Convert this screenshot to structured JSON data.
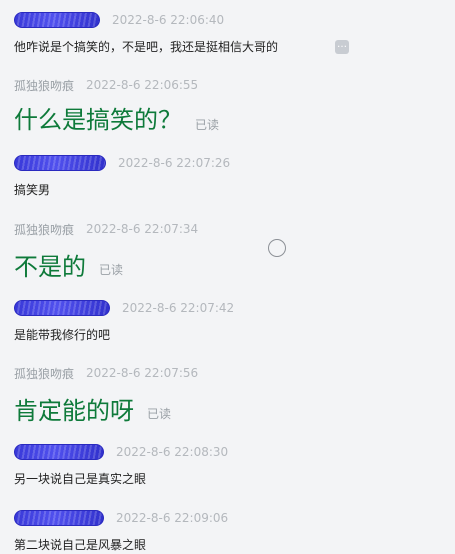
{
  "messages": [
    {
      "sender_redacted": true,
      "time": "2022-8-6 22:06:40",
      "text": "他咋说是个搞笑的，不是吧，我还是挺相信大哥的"
    },
    {
      "sender": "孤独狼吻痕",
      "time": "2022-8-6 22:06:55",
      "text": "什么是搞笑的？",
      "status": "已读"
    },
    {
      "sender_redacted": true,
      "time": "2022-8-6 22:07:26",
      "text": "搞笑男"
    },
    {
      "sender": "孤独狼吻痕",
      "time": "2022-8-6 22:07:34",
      "text": "不是的",
      "status": "已读"
    },
    {
      "sender_redacted": true,
      "time": "2022-8-6 22:07:42",
      "text": "是能带我修行的吧"
    },
    {
      "sender": "孤独狼吻痕",
      "time": "2022-8-6 22:07:56",
      "text": "肯定能的呀",
      "status": "已读"
    },
    {
      "sender_redacted": true,
      "time": "2022-8-6 22:08:30",
      "text": "另一块说自己是真实之眼"
    },
    {
      "sender_redacted": true,
      "time": "2022-8-6 22:09:06",
      "text": "第二块说自己是风暴之眼"
    }
  ],
  "icons": {
    "more": "more-options-icon",
    "cursor": "cursor-ring-icon"
  },
  "colors": {
    "accent_text": "#0e7a3a",
    "redaction": "#3838d8"
  }
}
